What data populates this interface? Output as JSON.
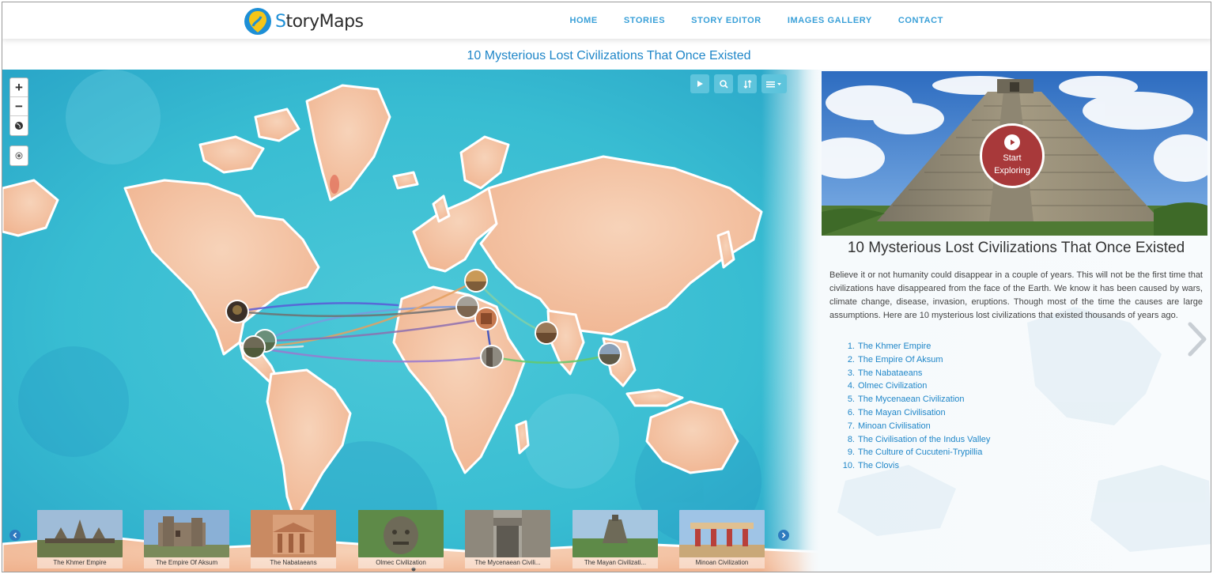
{
  "brand": {
    "name_prefix": "S",
    "name_rest": "tory",
    "name_suffix": "Maps"
  },
  "nav": {
    "items": [
      {
        "label": "HOME"
      },
      {
        "label": "STORIES"
      },
      {
        "label": "STORY EDITOR"
      },
      {
        "label": "IMAGES GALLERY"
      },
      {
        "label": "CONTACT"
      }
    ]
  },
  "page_title": "10 Mysterious Lost Civilizations That Once Existed",
  "map_controls": {
    "zoom_in": "+",
    "zoom_out": "−"
  },
  "thumbnails": [
    {
      "label": "The Khmer Empire"
    },
    {
      "label": "The Empire Of Aksum"
    },
    {
      "label": "The Nabataeans"
    },
    {
      "label": "Olmec Civilization"
    },
    {
      "label": "The Mycenaean Civili..."
    },
    {
      "label": "The Mayan Civilizati..."
    },
    {
      "label": "Minoan Civilization"
    }
  ],
  "panel": {
    "start_line1": "Start",
    "start_line2": "Exploring",
    "title": "10 Mysterious Lost Civilizations That Once Existed",
    "description": "Believe it or not humanity could disappear in a couple of years. This will not be the first time that civilizations have disappeared from the face of the Earth. We know it has been caused by wars, climate change, disease, invasion, eruptions. Though most of the time the causes are large assumptions. Here are 10 mysterious lost civilizations that existed thousands of years ago.",
    "list": [
      {
        "num": "1.",
        "label": "The Khmer Empire"
      },
      {
        "num": "2.",
        "label": "The Empire Of Aksum"
      },
      {
        "num": "3.",
        "label": "The Nabataeans"
      },
      {
        "num": "4.",
        "label": "Olmec Civilization"
      },
      {
        "num": "5.",
        "label": "The Mycenaean Civilization"
      },
      {
        "num": "6.",
        "label": "The Mayan Civilisation"
      },
      {
        "num": "7.",
        "label": "Minoan Civilisation"
      },
      {
        "num": "8.",
        "label": "The Civilisation of the Indus Valley"
      },
      {
        "num": "9.",
        "label": "The Culture of Cucuteni-Trypillia"
      },
      {
        "num": "10.",
        "label": "The Clovis"
      }
    ]
  },
  "colors": {
    "accent": "#1f86c8",
    "nav_link": "#3aa0d8",
    "ocean": "#3cc4d6",
    "land": "#f4c3a4",
    "start_button": "#a8393a"
  }
}
